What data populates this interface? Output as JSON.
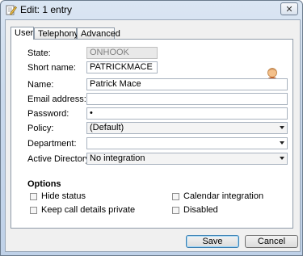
{
  "window": {
    "title": "Edit: 1 entry",
    "close_glyph": "✕"
  },
  "tabs": [
    {
      "label": "User",
      "active": true
    },
    {
      "label": "Telephony",
      "active": false
    },
    {
      "label": "Advanced",
      "active": false
    }
  ],
  "form": {
    "state_label": "State:",
    "state_value": "ONHOOK",
    "short_name_label": "Short name:",
    "short_name_value": "PATRICKMACE",
    "name_label": "Name:",
    "name_value": "Patrick Mace",
    "email_label": "Email address:",
    "email_value": "",
    "password_label": "Password:",
    "password_value": "•",
    "policy_label": "Policy:",
    "policy_value": "(Default)",
    "department_label": "Department:",
    "department_value": "",
    "ad_label": "Active Directory:",
    "ad_value": "No integration"
  },
  "options": {
    "title": "Options",
    "hide_status": "Hide status",
    "keep_call": "Keep call details private",
    "calendar": "Calendar integration",
    "disabled": "Disabled"
  },
  "buttons": {
    "save": "Save",
    "cancel": "Cancel"
  },
  "icons": {
    "title": "edit-pencil-icon",
    "avatar": "user-avatar-icon"
  }
}
